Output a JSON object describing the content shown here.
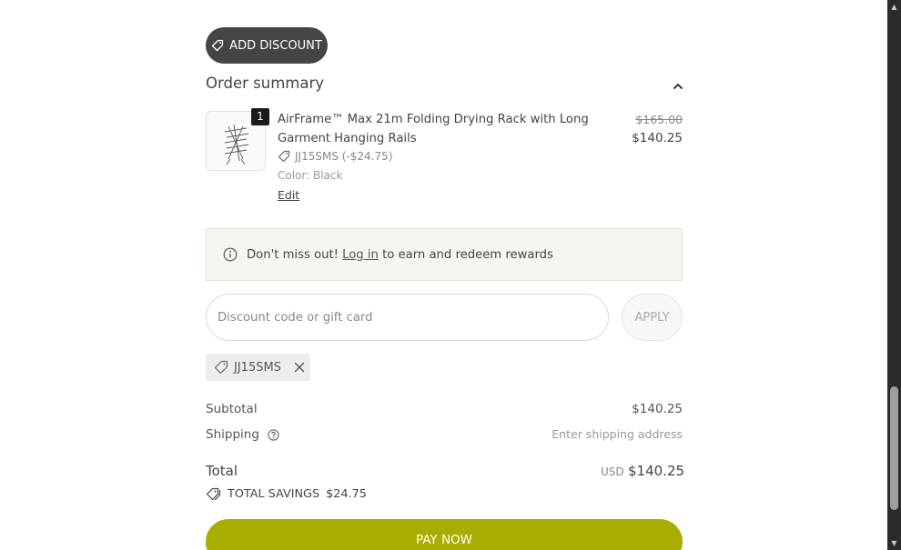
{
  "add_discount": {
    "label": "ADD DISCOUNT"
  },
  "order_summary": {
    "title": "Order summary",
    "item": {
      "quantity": "1",
      "name": "AirFrame™ Max 21m Folding Drying Rack with Long Garment Hanging Rails",
      "original_price": "$165.00",
      "price": "$140.25",
      "discount": "JJ15SMS (-$24.75)",
      "variant": "Color: Black",
      "edit_label": "Edit"
    }
  },
  "rewards": {
    "prefix": "Don't miss out!",
    "login_label": "Log in",
    "suffix": "to earn and redeem rewards"
  },
  "discount_form": {
    "placeholder": "Discount code or gift card",
    "apply_label": "APPLY",
    "applied_code": "JJ15SMS"
  },
  "totals": {
    "subtotal_label": "Subtotal",
    "subtotal_value": "$140.25",
    "shipping_label": "Shipping",
    "shipping_value": "Enter shipping address",
    "total_label": "Total",
    "currency": "USD",
    "total_value": "$140.25",
    "savings_label": "TOTAL SAVINGS",
    "savings_value": "$24.75"
  },
  "pay_button": {
    "label": "PAY NOW"
  },
  "colors": {
    "pay_button": "#a8ad00",
    "add_discount_button": "#454545",
    "rewards_bg": "#f6f6f1"
  }
}
